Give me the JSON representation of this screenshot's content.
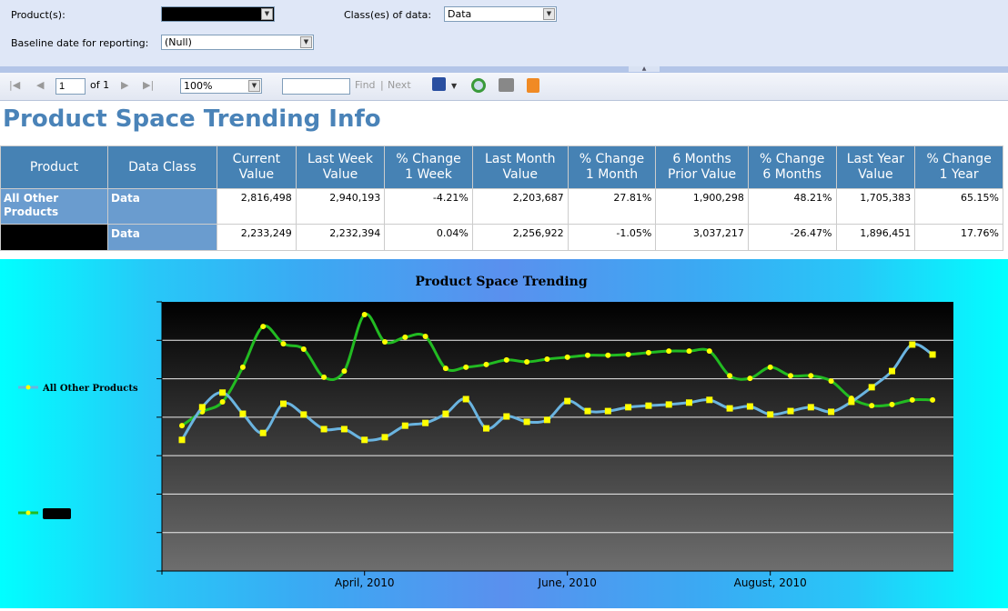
{
  "params": {
    "products_label": "Product(s):",
    "products_value": "",
    "class_label": "Class(es) of data:",
    "class_value": "Data",
    "baseline_label": "Baseline date for reporting:",
    "baseline_value": "(Null)"
  },
  "toolbar": {
    "page": "1",
    "of": "of 1",
    "zoom": "100%",
    "find": "Find",
    "sep": "|",
    "next": "Next",
    "icons": [
      "first-page-icon",
      "prev-page-icon",
      "next-page-icon",
      "last-page-icon",
      "export-icon",
      "refresh-icon",
      "print-icon",
      "data-feed-icon"
    ]
  },
  "report": {
    "title": "Product Space Trending Info",
    "headers": [
      [
        "Product"
      ],
      [
        "Data Class"
      ],
      [
        "Current",
        "Value"
      ],
      [
        "Last Week",
        "Value"
      ],
      [
        "% Change",
        "1 Week"
      ],
      [
        "Last Month",
        "Value"
      ],
      [
        "% Change",
        "1 Month"
      ],
      [
        "6 Months",
        "Prior Value"
      ],
      [
        "% Change",
        "6 Months"
      ],
      [
        "Last Year",
        "Value"
      ],
      [
        "% Change",
        "1 Year"
      ]
    ],
    "rows": [
      {
        "product": "All Other Products",
        "class": "Data",
        "values": [
          "2,816,498",
          "2,940,193",
          "-4.21%",
          "2,203,687",
          "27.81%",
          "1,900,298",
          "48.21%",
          "1,705,383",
          "65.15%"
        ]
      },
      {
        "product": "",
        "class": "Data",
        "values": [
          "2,233,249",
          "2,232,394",
          "0.04%",
          "2,256,922",
          "-1.05%",
          "3,037,217",
          "-26.47%",
          "1,896,451",
          "17.76%"
        ]
      }
    ]
  },
  "chart_data": {
    "type": "line",
    "title": "Product Space Trending",
    "xlabel": "",
    "ylabel": "",
    "ylim": [
      0,
      70
    ],
    "grid": true,
    "legend": "left",
    "x_ticks": [
      {
        "index": 9,
        "label": "April, 2010"
      },
      {
        "index": 19,
        "label": "June, 2010"
      },
      {
        "index": 29,
        "label": "August, 2010"
      }
    ],
    "colors": {
      "All Other Products": "#6ab4e0",
      "redacted": "#22bb22",
      "marker": "#ffff00"
    },
    "series": [
      {
        "name": "All Other Products",
        "values": [
          34.1,
          42.6,
          46.4,
          40.9,
          35.9,
          43.5,
          40.7,
          36.9,
          36.9,
          34.1,
          34.8,
          37.8,
          38.5,
          40.9,
          44.7,
          37.1,
          40.2,
          38.8,
          39.3,
          44.2,
          41.6,
          41.6,
          42.6,
          43.0,
          43.3,
          43.8,
          44.5,
          42.3,
          42.8,
          40.7,
          41.6,
          42.6,
          41.4,
          44.0,
          47.8,
          52.0,
          58.9,
          56.3
        ]
      },
      {
        "name": "",
        "values": [
          37.8,
          41.4,
          44.0,
          53.0,
          63.6,
          59.1,
          57.7,
          50.4,
          52.0,
          66.7,
          59.6,
          60.8,
          61.0,
          52.7,
          53.0,
          53.7,
          54.9,
          54.4,
          55.1,
          55.6,
          56.1,
          56.1,
          56.3,
          56.8,
          57.2,
          57.2,
          57.2,
          50.8,
          50.1,
          53.0,
          50.8,
          50.8,
          49.4,
          44.9,
          43.0,
          43.3,
          44.5,
          44.5
        ]
      }
    ]
  }
}
